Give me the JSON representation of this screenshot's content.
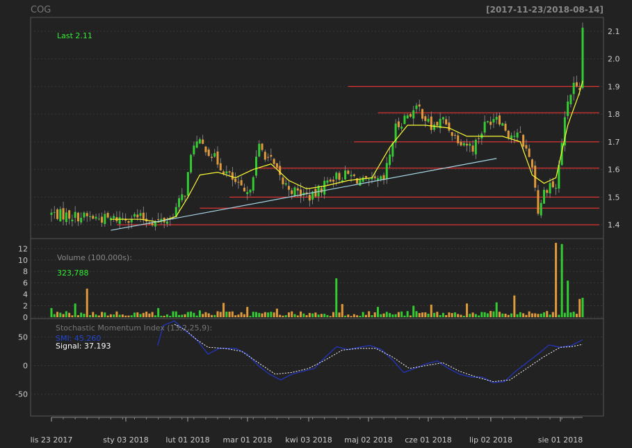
{
  "header": {
    "symbol": "COG",
    "date_range": "[2017-11-23/2018-08-14]"
  },
  "colors": {
    "background": "#222222",
    "grid": "#3a3a3a",
    "axis_text": "#cccccc",
    "up": "#33cc33",
    "down": "#e09a3a",
    "wick": "#999999",
    "sma": "#ffff33",
    "trendline": "#a8d8e8",
    "hline": "#dd3333",
    "last_label": "#33ee33",
    "smi": "#2233aa",
    "signal": "#ffffff"
  },
  "chart_data": [
    {
      "type": "candlestick",
      "name": "price",
      "title": "COG",
      "ylim": [
        1.35,
        2.15
      ],
      "yticks": [
        1.4,
        1.5,
        1.6,
        1.7,
        1.8,
        1.9,
        2.0,
        2.1
      ],
      "ytick_labels": [
        "1.4",
        "1.5",
        "1.6",
        "1.7",
        "1.8",
        "1.9",
        "2.0",
        "2.1"
      ],
      "last_label": "Last 2.11",
      "n_bars": 180,
      "anchors_close": [
        [
          0,
          1.44
        ],
        [
          10,
          1.43
        ],
        [
          20,
          1.42
        ],
        [
          28,
          1.43
        ],
        [
          35,
          1.41
        ],
        [
          40,
          1.42
        ],
        [
          45,
          1.52
        ],
        [
          48,
          1.7
        ],
        [
          52,
          1.68
        ],
        [
          58,
          1.6
        ],
        [
          62,
          1.55
        ],
        [
          66,
          1.5
        ],
        [
          70,
          1.68
        ],
        [
          74,
          1.63
        ],
        [
          78,
          1.55
        ],
        [
          82,
          1.52
        ],
        [
          88,
          1.5
        ],
        [
          94,
          1.57
        ],
        [
          100,
          1.58
        ],
        [
          106,
          1.55
        ],
        [
          112,
          1.56
        ],
        [
          116,
          1.75
        ],
        [
          120,
          1.8
        ],
        [
          124,
          1.82
        ],
        [
          128,
          1.75
        ],
        [
          132,
          1.78
        ],
        [
          136,
          1.72
        ],
        [
          142,
          1.68
        ],
        [
          146,
          1.76
        ],
        [
          150,
          1.8
        ],
        [
          154,
          1.73
        ],
        [
          158,
          1.72
        ],
        [
          162,
          1.62
        ],
        [
          164,
          1.45
        ],
        [
          166,
          1.52
        ],
        [
          168,
          1.55
        ],
        [
          170,
          1.53
        ],
        [
          172,
          1.7
        ],
        [
          174,
          1.85
        ],
        [
          176,
          1.9
        ],
        [
          178,
          1.87
        ],
        [
          179,
          2.11
        ]
      ],
      "sma_anchors": [
        [
          20,
          1.42
        ],
        [
          30,
          1.42
        ],
        [
          36,
          1.41
        ],
        [
          42,
          1.43
        ],
        [
          46,
          1.5
        ],
        [
          50,
          1.58
        ],
        [
          56,
          1.59
        ],
        [
          62,
          1.57
        ],
        [
          68,
          1.6
        ],
        [
          74,
          1.62
        ],
        [
          80,
          1.56
        ],
        [
          86,
          1.53
        ],
        [
          92,
          1.54
        ],
        [
          100,
          1.56
        ],
        [
          108,
          1.57
        ],
        [
          114,
          1.68
        ],
        [
          120,
          1.76
        ],
        [
          126,
          1.76
        ],
        [
          134,
          1.75
        ],
        [
          140,
          1.72
        ],
        [
          146,
          1.72
        ],
        [
          152,
          1.72
        ],
        [
          158,
          1.7
        ],
        [
          162,
          1.58
        ],
        [
          166,
          1.55
        ],
        [
          170,
          1.57
        ],
        [
          174,
          1.76
        ],
        [
          178,
          1.88
        ],
        [
          179,
          1.92
        ]
      ],
      "hlines": [
        1.9,
        1.805,
        1.7,
        1.605,
        1.5,
        1.46,
        1.4
      ],
      "hline_starts": [
        100,
        110,
        102,
        70,
        60,
        50,
        22
      ],
      "trendline": {
        "x0": 20,
        "y0": 1.38,
        "x1": 150,
        "y1": 1.64
      },
      "xaxis_labels": [
        "lis 23 2017",
        "sty 03 2018",
        "lut 01 2018",
        "mar 01 2018",
        "kwi 03 2018",
        "maj 02 2018",
        "cze 01 2018",
        "lip 02 2018",
        "sie 01 2018"
      ]
    },
    {
      "type": "bar",
      "name": "volume",
      "title": "Volume (100,000s):",
      "value_label": "323,788",
      "ylim": [
        0,
        13.5
      ],
      "yticks": [
        0,
        2,
        4,
        6,
        8,
        10,
        12
      ],
      "ytick_labels": [
        "0",
        "2",
        "4",
        "6",
        "8",
        "10",
        "12"
      ],
      "spikes": [
        [
          0,
          1.6
        ],
        [
          8,
          2.4
        ],
        [
          12,
          5.0
        ],
        [
          36,
          1.6
        ],
        [
          50,
          1.2
        ],
        [
          58,
          2.5
        ],
        [
          66,
          1.8
        ],
        [
          76,
          1.5
        ],
        [
          96,
          6.8
        ],
        [
          98,
          2.3
        ],
        [
          110,
          1.8
        ],
        [
          122,
          2.0
        ],
        [
          128,
          2.2
        ],
        [
          140,
          2.4
        ],
        [
          150,
          2.6
        ],
        [
          156,
          3.8
        ],
        [
          170,
          13.0
        ],
        [
          172,
          12.8
        ],
        [
          174,
          6.4
        ],
        [
          178,
          3.2
        ],
        [
          179,
          3.4
        ]
      ]
    },
    {
      "type": "line",
      "name": "smi",
      "title": "Stochastic Momentum Index (13,2,25,9):",
      "smi_label": "SMI: 45.260",
      "signal_label": "Signal: 37.193",
      "ylim": [
        -88,
        82
      ],
      "yticks": [
        -50,
        0,
        50
      ],
      "ytick_labels": [
        "-50",
        "0",
        "50"
      ],
      "smi_anchors": [
        [
          38,
          35
        ],
        [
          40,
          70
        ],
        [
          44,
          78
        ],
        [
          48,
          60
        ],
        [
          52,
          45
        ],
        [
          56,
          20
        ],
        [
          60,
          30
        ],
        [
          66,
          30
        ],
        [
          70,
          20
        ],
        [
          74,
          0
        ],
        [
          78,
          -15
        ],
        [
          82,
          -25
        ],
        [
          86,
          -15
        ],
        [
          90,
          -10
        ],
        [
          94,
          -5
        ],
        [
          98,
          15
        ],
        [
          102,
          33
        ],
        [
          106,
          28
        ],
        [
          110,
          32
        ],
        [
          114,
          35
        ],
        [
          118,
          28
        ],
        [
          122,
          10
        ],
        [
          126,
          -12
        ],
        [
          130,
          -5
        ],
        [
          134,
          3
        ],
        [
          138,
          8
        ],
        [
          142,
          -5
        ],
        [
          146,
          -15
        ],
        [
          150,
          -20
        ],
        [
          154,
          -20
        ],
        [
          158,
          -30
        ],
        [
          162,
          -28
        ],
        [
          166,
          -10
        ],
        [
          170,
          5
        ],
        [
          174,
          20
        ],
        [
          178,
          36
        ],
        [
          182,
          32
        ],
        [
          186,
          35
        ],
        [
          190,
          45
        ]
      ],
      "signal_anchors": [
        [
          44,
          72
        ],
        [
          48,
          62
        ],
        [
          52,
          45
        ],
        [
          56,
          32
        ],
        [
          62,
          30
        ],
        [
          68,
          25
        ],
        [
          74,
          5
        ],
        [
          80,
          -15
        ],
        [
          86,
          -12
        ],
        [
          92,
          -5
        ],
        [
          98,
          10
        ],
        [
          104,
          27
        ],
        [
          110,
          30
        ],
        [
          116,
          30
        ],
        [
          122,
          15
        ],
        [
          128,
          -5
        ],
        [
          134,
          0
        ],
        [
          140,
          5
        ],
        [
          146,
          -10
        ],
        [
          152,
          -20
        ],
        [
          158,
          -28
        ],
        [
          164,
          -25
        ],
        [
          170,
          -5
        ],
        [
          176,
          15
        ],
        [
          182,
          32
        ],
        [
          186,
          33
        ],
        [
          190,
          37
        ]
      ]
    }
  ]
}
